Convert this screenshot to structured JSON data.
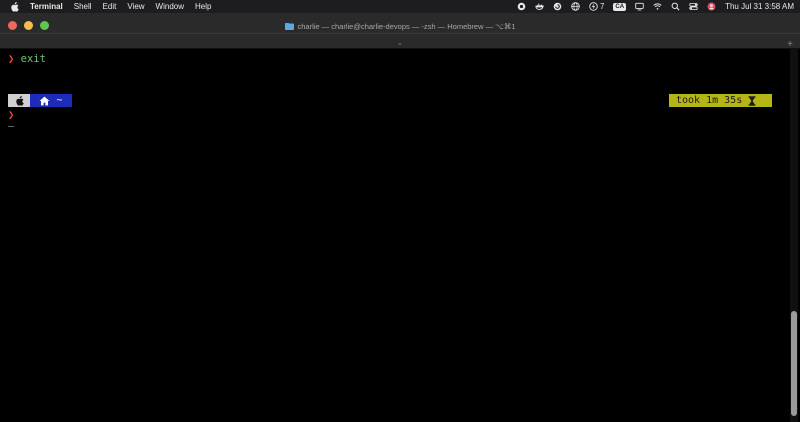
{
  "menubar": {
    "app_name": "Terminal",
    "menus": [
      "Shell",
      "Edit",
      "View",
      "Window",
      "Help"
    ],
    "status_count": "7",
    "input_source": "CA",
    "datetime": "Thu Jul 31  3:58 AM"
  },
  "window": {
    "title": "charlie — charlie@charlie-devops — -zsh — Homebrew — ⌥⌘1",
    "tab_chevron": "⌄",
    "new_tab": "+"
  },
  "terminal": {
    "prompt_symbol": "❯",
    "line1_command": "exit",
    "dir_segment": "~",
    "took_text": "took 1m 35s",
    "cursor": "_"
  },
  "colors": {
    "prompt": "#e44848",
    "command": "#6ec36e",
    "dir_segment_bg": "#1c2bb8",
    "took_bg": "#b5b515"
  }
}
